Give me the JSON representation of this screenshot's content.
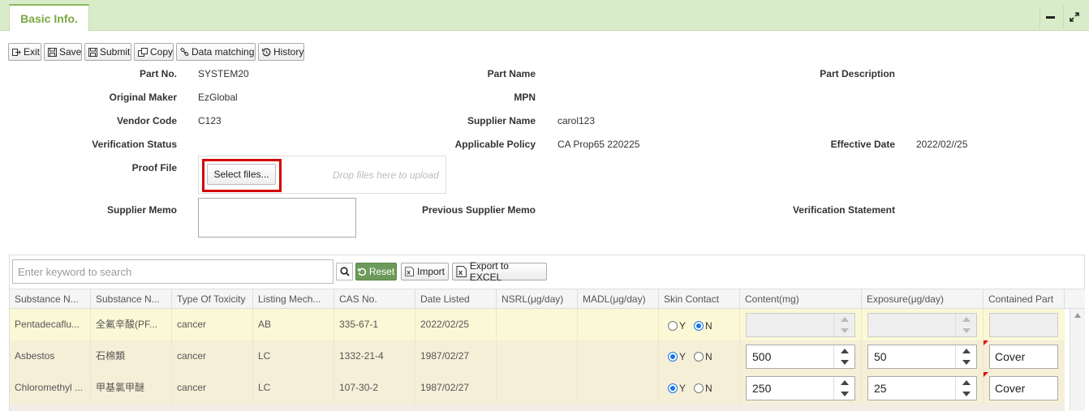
{
  "tab": {
    "label": "Basic Info."
  },
  "toolbar": {
    "exit": "Exit",
    "save": "Save",
    "submit": "Submit",
    "copy": "Copy",
    "data_matching": "Data matching",
    "history": "History"
  },
  "form": {
    "part_no_label": "Part No.",
    "part_no_value": "SYSTEM20",
    "part_name_label": "Part Name",
    "part_desc_label": "Part Description",
    "original_maker_label": "Original Maker",
    "original_maker_value": "EzGlobal",
    "mpn_label": "MPN",
    "vendor_code_label": "Vendor Code",
    "vendor_code_value": "C123",
    "supplier_name_label": "Supplier Name",
    "supplier_name_value": "carol123",
    "verification_status_label": "Verification Status",
    "applicable_policy_label": "Applicable Policy",
    "applicable_policy_value": "CA Prop65 220225",
    "effective_date_label": "Effective Date",
    "effective_date_value": "2022/02//25",
    "proof_file_label": "Proof File",
    "select_files": "Select files...",
    "drop_text": "Drop files here to upload",
    "supplier_memo_label": "Supplier Memo",
    "previous_supplier_memo_label": "Previous Supplier Memo",
    "verification_statement_label": "Verification Statement"
  },
  "grid": {
    "search_placeholder": "Enter keyword to search",
    "reset": "Reset",
    "import": "Import",
    "export": "Export to EXCEL",
    "columns": [
      "Substance N...",
      "Substance N...",
      "Type Of Toxicity",
      "Listing Mech...",
      "CAS No.",
      "Date Listed",
      "NSRL(μg/day)",
      "MADL(μg/day)",
      "Skin Contact",
      "Content(mg)",
      "Exposure(μg/day)",
      "Contained Part"
    ],
    "radio_y": "Y",
    "radio_n": "N",
    "rows": [
      {
        "name_en": "Pentadecaflu...",
        "name_zh": "全氟辛酸(PF...",
        "toxicity": "cancer",
        "mechanism": "AB",
        "cas": "335-67-1",
        "date": "2022/02/25",
        "nsrl": "",
        "madl": "",
        "skin": "N",
        "content": "",
        "exposure": "",
        "part": "",
        "disabled": true
      },
      {
        "name_en": "Asbestos",
        "name_zh": "石棉類",
        "toxicity": "cancer",
        "mechanism": "LC",
        "cas": "1332-21-4",
        "date": "1987/02/27",
        "nsrl": "",
        "madl": "",
        "skin": "Y",
        "content": "500",
        "exposure": "50",
        "part": "Cover",
        "disabled": false
      },
      {
        "name_en": "Chloromethyl ...",
        "name_zh": "甲基氯甲醚",
        "toxicity": "cancer",
        "mechanism": "LC",
        "cas": "107-30-2",
        "date": "1987/02/27",
        "nsrl": "",
        "madl": "",
        "skin": "Y",
        "content": "250",
        "exposure": "25",
        "part": "Cover",
        "disabled": false
      }
    ]
  },
  "colors": {
    "tab_green": "#7aa83e",
    "tabbar_bg": "#d9ecc9",
    "reset_btn": "#6c9a5b",
    "row_disabled": "#fbf8d6",
    "row_normal": "#f6efd8",
    "highlight": "#d40000"
  }
}
